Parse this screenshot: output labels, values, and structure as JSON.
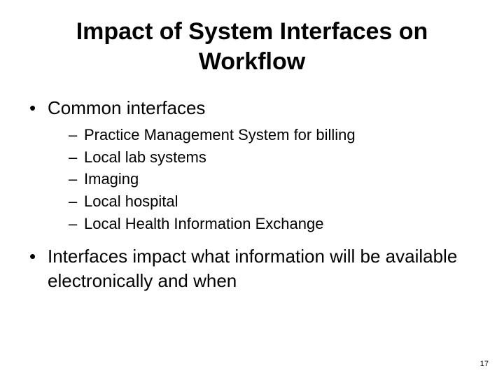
{
  "title": "Impact of System Interfaces on Workflow",
  "bullets": [
    {
      "text": "Common interfaces",
      "sub": [
        "Practice Management System for billing",
        "Local lab systems",
        "Imaging",
        "Local hospital",
        "Local Health Information Exchange"
      ]
    },
    {
      "text": "Interfaces impact what information will be available electronically and when",
      "sub": []
    }
  ],
  "page_number": "17"
}
